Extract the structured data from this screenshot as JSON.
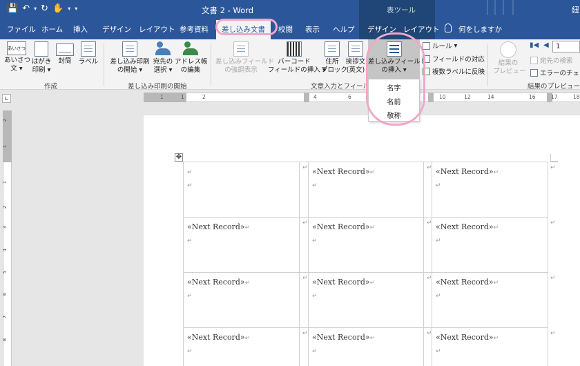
{
  "titlebar": {
    "doc_title": "文書 2  -  Word",
    "context_label": "表ツール",
    "user_partial": "紐",
    "qat": [
      "save-icon",
      "undo-icon",
      "redo-icon",
      "touch-mode-icon",
      "customize-caret-icon"
    ]
  },
  "tabs": {
    "file": "ファイル",
    "home": "ホーム",
    "insert": "挿入",
    "design": "デザイン",
    "layout": "レイアウト",
    "references": "参考資料",
    "mailings": "差し込み文書",
    "review": "校閲",
    "view": "表示",
    "help": "ヘルプ",
    "table_design": "デザイン",
    "table_layout": "レイアウト",
    "tell_me": "何をしますか"
  },
  "ribbon": {
    "create": {
      "group_label": "作成",
      "greeting_l1": "あいさつ",
      "greeting_l2": "文",
      "postcard_l1": "はがき",
      "postcard_l2": "印刷",
      "envelope": "封筒",
      "label": "ラベル",
      "greeting_icon_text": "あいさつ"
    },
    "start_merge": {
      "group_label": "差し込み印刷の開始",
      "start_l1": "差し込み印刷",
      "start_l2": "の開始",
      "recipients_l1": "宛先の",
      "recipients_l2": "選択",
      "edit_l1": "アドレス帳",
      "edit_l2": "の編集"
    },
    "write_insert": {
      "group_label": "文章入力とフィールド",
      "highlight_l1": "差し込みフィールド",
      "highlight_l2": "の強調表示",
      "barcode_l1": "バーコード",
      "barcode_l2": "フィールドの挿入",
      "address_l1": "住所",
      "address_l2": "ブロック",
      "greeting_l1": "挨拶文",
      "greeting_l2": "(英文)",
      "insert_field_l1": "差し込みフィールド",
      "insert_field_l2": "の挿入",
      "rules": "ルール",
      "match_fields": "フィールドの対応",
      "update_labels": "複数ラベルに反映"
    },
    "preview": {
      "group_label": "結果のプレビュー",
      "preview_l1": "結果の",
      "preview_l2": "プレビュー",
      "record_value": "1",
      "find_recipient": "宛先の検索",
      "check_errors": "エラーのチェック"
    }
  },
  "dropdown": {
    "items": [
      "名字",
      "名前",
      "敬称"
    ]
  },
  "ruler": {
    "marks": [
      "1",
      "1",
      "2",
      "4",
      "6",
      "8",
      "10",
      "12",
      "14",
      "16",
      "17",
      "18"
    ]
  },
  "vruler": {
    "marks": [
      "2",
      "1",
      "1",
      "2",
      "3",
      "4",
      "5",
      "6",
      "7",
      "8"
    ]
  },
  "document": {
    "field_text": "«Next Record»",
    "para_mark": "↵",
    "cell_end": "↵"
  },
  "colors": {
    "word_blue": "#2b579a",
    "highlight_pink": "#f2a7c8"
  }
}
